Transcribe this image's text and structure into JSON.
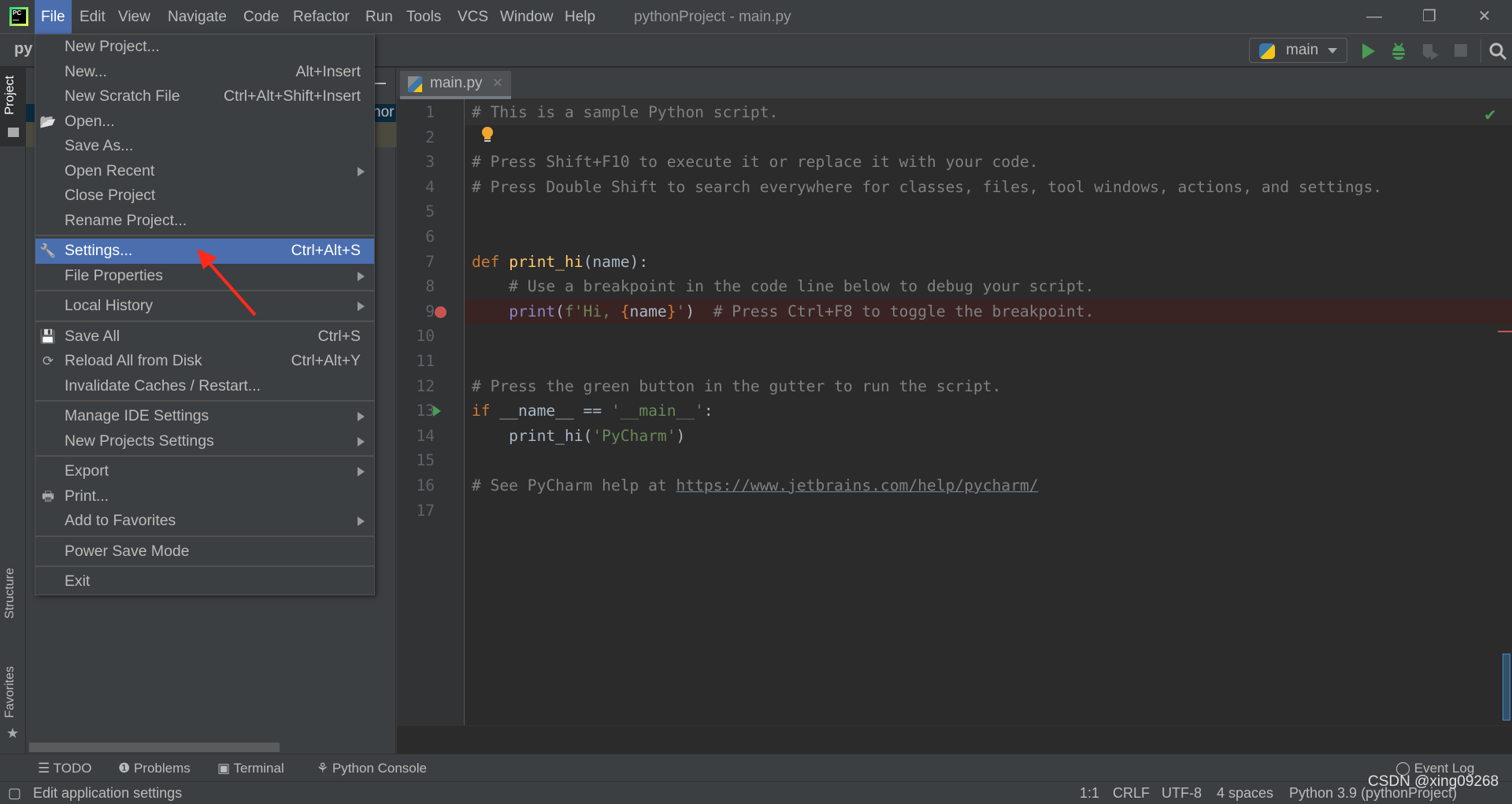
{
  "titlebar": {
    "menus": [
      "File",
      "Edit",
      "View",
      "Navigate",
      "Code",
      "Refactor",
      "Run",
      "Tools",
      "VCS",
      "Window",
      "Help"
    ],
    "active_menu": "File",
    "window_title": "pythonProject - main.py",
    "minimize": "—",
    "restore": "❐",
    "close": "✕"
  },
  "toolbar": {
    "project_name_fragment": "py",
    "run_config": "main",
    "run_icon": "play-icon",
    "debug_icon": "bug-icon",
    "search_icon": "search-icon"
  },
  "sidebar": {
    "tabs": [
      "Project",
      "Structure",
      "Favorites"
    ]
  },
  "project_panel": {
    "row_fragment": "hor"
  },
  "editor": {
    "tab_label": "main.py",
    "lines": [
      [
        [
          "# This is a sample Python script.",
          "c"
        ]
      ],
      [],
      [
        [
          "# Press Shift+F10 to execute it or replace it with your code.",
          "c"
        ]
      ],
      [
        [
          "# Press Double Shift to search everywhere for classes, files, tool windows, actions, and settings.",
          "c"
        ]
      ],
      [],
      [],
      [
        [
          "def ",
          "k"
        ],
        [
          "print_hi",
          "f"
        ],
        [
          "(name):",
          "t"
        ]
      ],
      [
        [
          "    # Use a breakpoint in the code line below to debug your script.",
          "c"
        ]
      ],
      [
        [
          "    ",
          "t"
        ],
        [
          "print",
          "b"
        ],
        [
          "(",
          "t"
        ],
        [
          "f'Hi, ",
          "s"
        ],
        [
          "{",
          "k"
        ],
        [
          "name",
          "t"
        ],
        [
          "}",
          "k"
        ],
        [
          "'",
          "s"
        ],
        [
          ")  ",
          "t"
        ],
        [
          "# Press Ctrl+F8 to toggle the breakpoint.",
          "c"
        ]
      ],
      [],
      [],
      [
        [
          "# Press the green button in the gutter to run the script.",
          "c"
        ]
      ],
      [
        [
          "if ",
          "k"
        ],
        [
          "__name__ == ",
          "t"
        ],
        [
          "'__main__'",
          "s"
        ],
        [
          ":",
          "t"
        ]
      ],
      [
        [
          "    print_hi(",
          "t"
        ],
        [
          "'PyCharm'",
          "s"
        ],
        [
          ")",
          "t"
        ]
      ],
      [],
      [
        [
          "# See PyCharm help at ",
          "c"
        ],
        [
          "https://www.jetbrains.com/help/pycharm/",
          "l"
        ]
      ],
      []
    ],
    "breakpoint_line": 9,
    "run_gutter_line": 13,
    "current_line": 1
  },
  "file_menu": [
    {
      "label": "New Project..."
    },
    {
      "label": "New...",
      "shortcut": "Alt+Insert"
    },
    {
      "label": "New Scratch File",
      "shortcut": "Ctrl+Alt+Shift+Insert"
    },
    {
      "label": "Open...",
      "icon": "folder-open-icon"
    },
    {
      "label": "Save As..."
    },
    {
      "label": "Open Recent",
      "submenu": true
    },
    {
      "label": "Close Project"
    },
    {
      "label": "Rename Project..."
    },
    {
      "sep": true
    },
    {
      "label": "Settings...",
      "shortcut": "Ctrl+Alt+S",
      "icon": "wrench-icon",
      "selected": true
    },
    {
      "label": "File Properties",
      "submenu": true
    },
    {
      "sep": true
    },
    {
      "label": "Local History",
      "submenu": true
    },
    {
      "sep": true
    },
    {
      "label": "Save All",
      "shortcut": "Ctrl+S",
      "icon": "save-icon"
    },
    {
      "label": "Reload All from Disk",
      "shortcut": "Ctrl+Alt+Y",
      "icon": "reload-icon"
    },
    {
      "label": "Invalidate Caches / Restart..."
    },
    {
      "sep": true
    },
    {
      "label": "Manage IDE Settings",
      "submenu": true
    },
    {
      "label": "New Projects Settings",
      "submenu": true
    },
    {
      "sep": true
    },
    {
      "label": "Export",
      "submenu": true
    },
    {
      "label": "Print...",
      "icon": "printer-icon"
    },
    {
      "label": "Add to Favorites",
      "submenu": true
    },
    {
      "sep": true
    },
    {
      "label": "Power Save Mode"
    },
    {
      "sep": true
    },
    {
      "label": "Exit"
    }
  ],
  "tool_windows": [
    "TODO",
    "Problems",
    "Terminal",
    "Python Console"
  ],
  "event_log": "Event Log",
  "status": {
    "message": "Edit application settings",
    "position": "1:1",
    "line_sep": "CRLF",
    "encoding": "UTF-8",
    "indent": "4 spaces",
    "interpreter": "Python 3.9 (pythonProject)",
    "watermark": "CSDN @xing09268"
  },
  "colors": {
    "accent": "#4b6eaf",
    "annotation_arrow": "#ff2a1a",
    "breakpoint": "#c75450",
    "run": "#499c54"
  }
}
